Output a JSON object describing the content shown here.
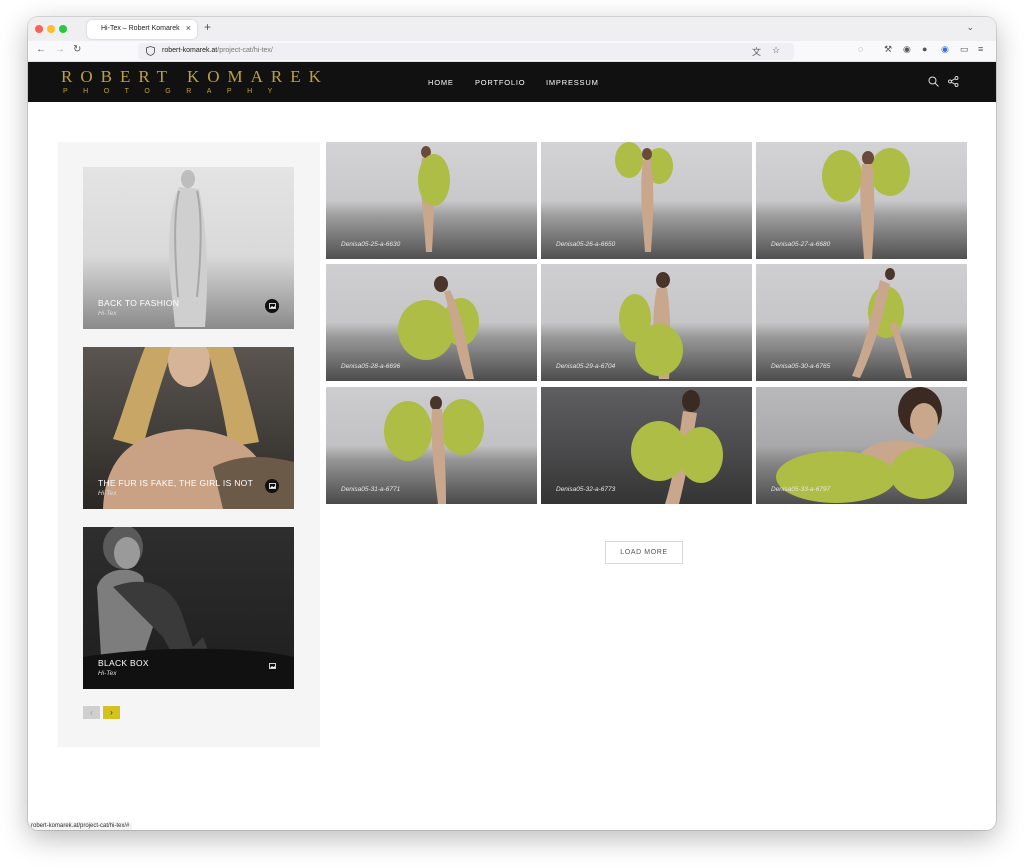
{
  "browser": {
    "tab_title": "Hi-Tex – Robert Komarek",
    "tab_close": "×",
    "new_tab": "+",
    "url_domain": "robert-komarek.at",
    "url_path": "/project-cat/hi-tex/",
    "status_url": "robert-komarek.at/project-cat/hi-tex/#"
  },
  "site": {
    "logo_main": "ROBERT KOMAREK",
    "logo_sub": "PHOTOGRAPHY",
    "menu": [
      "HOME",
      "PORTFOLIO",
      "IMPRESSUM"
    ],
    "accent_color": "#bfa13b"
  },
  "sidebar": {
    "cards": [
      {
        "title": "BACK TO FASHION",
        "subtitle": "Hi-Tex"
      },
      {
        "title": "THE FUR IS FAKE, THE GIRL IS NOT",
        "subtitle": "Hi-Tex"
      },
      {
        "title": "BLACK BOX",
        "subtitle": "Hi-Tex"
      }
    ],
    "pager_prev": "‹",
    "pager_next": "›",
    "pager_active_color": "#d4c21e"
  },
  "gallery": {
    "items": [
      {
        "label": "Denisa05-25-a-6630"
      },
      {
        "label": "Denisa05-26-a-6650"
      },
      {
        "label": "Denisa05-27-a-6680"
      },
      {
        "label": "Denisa05-28-a-6696"
      },
      {
        "label": "Denisa05-29-a-6704"
      },
      {
        "label": "Denisa05-30-a-6765"
      },
      {
        "label": "Denisa05-31-a-6771"
      },
      {
        "label": "Denisa05-32-a-6773"
      },
      {
        "label": "Denisa05-33-a-6797"
      }
    ],
    "load_more": "LOAD MORE"
  }
}
